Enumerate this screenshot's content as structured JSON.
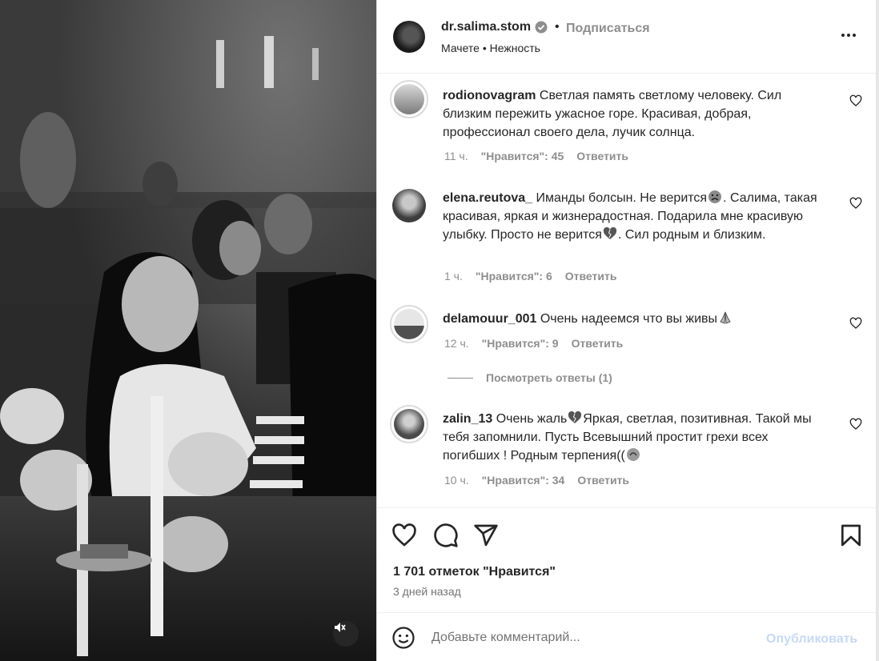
{
  "post": {
    "username": "dr.salima.stom",
    "separator": "•",
    "follow_label": "Подписаться",
    "subtitle": "Мачете • Нежность"
  },
  "comments": [
    {
      "username": "rodionovagram",
      "text": "Светлая память светлому человеку. Сил близким пережить ужасное горе. Красивая, добрая, профессионал своего дела, лучик солнца.",
      "time": "11 ч.",
      "likes": "\"Нравится\": 45",
      "reply": "Ответить"
    },
    {
      "username": "elena.reutova_",
      "text_part1": "Иманды болсын. Не верится",
      "text_part2": ". Салима, такая красивая, яркая и жизнерадостная. Подарила мне красивую улыбку. Просто не верится",
      "text_part3": ". Сил родным и близким.",
      "time": "1 ч.",
      "likes": "\"Нравится\": 6",
      "reply": "Ответить"
    },
    {
      "username": "delamouur_001",
      "text": "Очень надеемся что вы живы",
      "time": "12 ч.",
      "likes": "\"Нравится\": 9",
      "reply": "Ответить"
    },
    {
      "username": "zalin_13",
      "text_part1": "Очень жаль",
      "text_part2": "Яркая, светлая, позитивная. Такой мы тебя запомнили. Пусть Всевышний простит грехи всех погибших ! Родным терпения((",
      "time": "10 ч.",
      "likes": "\"Нравится\": 34",
      "reply": "Ответить"
    }
  ],
  "view_replies": "Посмотреть ответы (1)",
  "likes_total": "1 701 отметок \"Нравится\"",
  "posted_ago": "3 дней назад",
  "comment_input": {
    "placeholder": "Добавьте комментарий..."
  },
  "publish_label": "Опубликовать",
  "icons": {
    "verified": "verified-badge-icon",
    "more": "more-options-icon",
    "heart": "heart-icon",
    "comment": "comment-icon",
    "share": "share-icon",
    "save": "bookmark-icon",
    "emoji": "emoji-icon",
    "mute": "muted-speaker-icon"
  }
}
